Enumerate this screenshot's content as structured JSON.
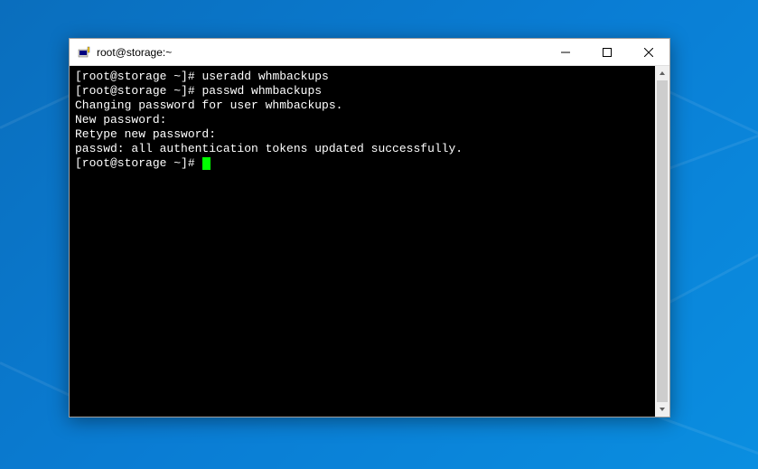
{
  "window": {
    "title": "root@storage:~"
  },
  "terminal": {
    "lines": [
      {
        "prompt": "[root@storage ~]# ",
        "command": "useradd whmbackups"
      },
      {
        "prompt": "[root@storage ~]# ",
        "command": "passwd whmbackups"
      },
      {
        "prompt": "",
        "command": "Changing password for user whmbackups."
      },
      {
        "prompt": "",
        "command": "New password:"
      },
      {
        "prompt": "",
        "command": "Retype new password:"
      },
      {
        "prompt": "",
        "command": "passwd: all authentication tokens updated successfully."
      },
      {
        "prompt": "[root@storage ~]# ",
        "command": "",
        "cursor": true
      }
    ]
  }
}
